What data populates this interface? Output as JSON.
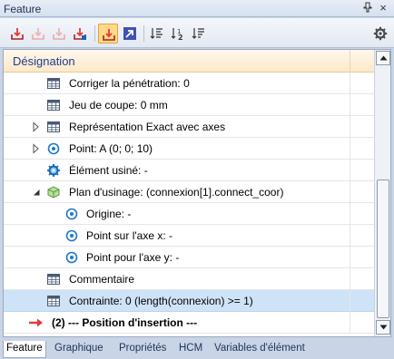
{
  "window": {
    "title": "Feature"
  },
  "titlebar": {
    "pin_glyph": "⬇",
    "close_glyph": "×"
  },
  "toolbar": {
    "buttons": [
      {
        "name": "insert-feature-icon"
      },
      {
        "name": "insert-feature-disabled-icon"
      },
      {
        "name": "insert-feature-disabled-2-icon"
      },
      {
        "name": "insert-feature-alt-icon"
      },
      {
        "name": "insert-feature-active-icon"
      },
      {
        "name": "navigate-arrow-icon"
      },
      {
        "name": "sort-list-icon"
      },
      {
        "name": "sort-numbered-icon"
      },
      {
        "name": "sort-filter-icon"
      },
      {
        "name": "gear-icon"
      }
    ]
  },
  "grid": {
    "header": "Désignation",
    "rows": [
      {
        "label": "Corriger la pénétration: 0"
      },
      {
        "label": "Jeu de coupe: 0 mm"
      },
      {
        "label": "Représentation  Exact avec axes"
      },
      {
        "label": "Point: A  (0; 0; 10)"
      },
      {
        "label": "Élément usiné: -"
      },
      {
        "label": "Plan d'usinage: (connexion[1].connect_coor)"
      },
      {
        "label": "Origine: -"
      },
      {
        "label": "Point sur l'axe x: -"
      },
      {
        "label": "Point pour l'axe y: -"
      },
      {
        "label": "Commentaire"
      },
      {
        "label": "Contrainte: 0 (length(connexion) >= 1)"
      },
      {
        "label": "(2) --- Position  d'insertion ---"
      }
    ]
  },
  "tabs": [
    {
      "label": "Feature"
    },
    {
      "label": "Graphique"
    },
    {
      "label": "Propriétés"
    },
    {
      "label": "HCM"
    },
    {
      "label": "Variables d'élément"
    }
  ],
  "colors": {
    "header_text": "#1f3c8f",
    "selected_row": "#cfe3f8",
    "active_tool": "#ffd98a",
    "arrow_red": "#e53935"
  }
}
